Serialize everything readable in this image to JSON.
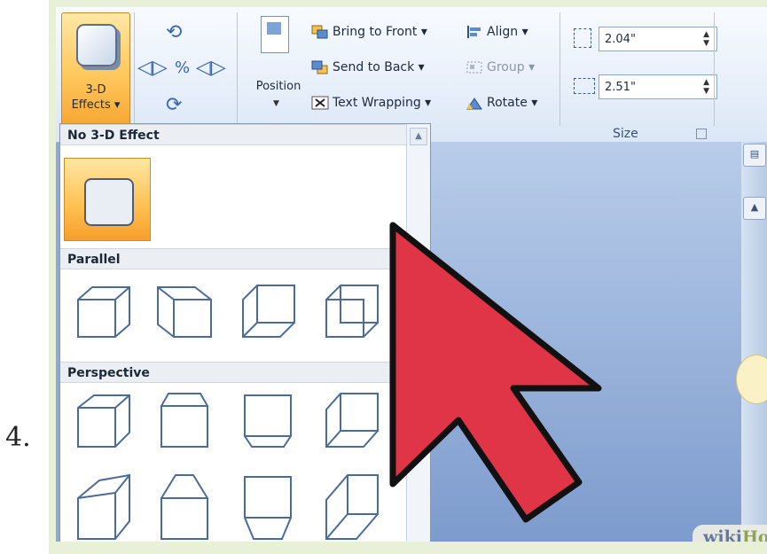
{
  "step_number": "4.",
  "ribbon": {
    "three_d_effects_label_line1": "3-D",
    "three_d_effects_label_line2": "Effects ▾",
    "position_label": "Position",
    "bring_to_front": "Bring to Front ▾",
    "send_to_back": "Send to Back ▾",
    "text_wrapping": "Text Wrapping ▾",
    "align": "Align ▾",
    "group": "Group ▾",
    "rotate": "Rotate ▾",
    "height_value": "2.04\"",
    "width_value": "2.51\"",
    "size_group_label": "Size",
    "dialog_launcher_icon": "dialog-launcher-icon"
  },
  "gallery": {
    "section_no_effect": "No 3-D Effect",
    "section_parallel": "Parallel",
    "section_perspective": "Perspective",
    "selected_item": "No 3-D Effect"
  },
  "watermark": {
    "part1": "wiki",
    "part2": "How"
  },
  "colors": {
    "arrow_fill": "#e03546",
    "selection_orange": "#ffbf4f",
    "document_blue": "#8fa9d6"
  }
}
